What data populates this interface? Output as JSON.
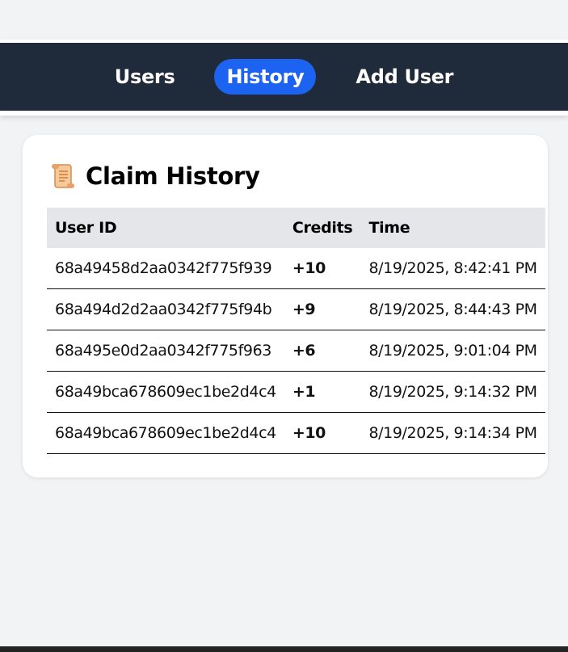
{
  "nav": {
    "items": [
      {
        "label": "Users",
        "active": false
      },
      {
        "label": "History",
        "active": true
      },
      {
        "label": "Add User",
        "active": false
      }
    ],
    "active_color": "#1c63f2",
    "background_color": "#1f2a3a"
  },
  "card": {
    "icon": "scroll-icon",
    "title": "Claim History",
    "columns": [
      "User ID",
      "Credits",
      "Time"
    ],
    "rows": [
      {
        "user_id": "68a49458d2aa0342f775f939",
        "credits": "+10",
        "time": "8/19/2025, 8:42:41 PM"
      },
      {
        "user_id": "68a494d2d2aa0342f775f94b",
        "credits": "+9",
        "time": "8/19/2025, 8:44:43 PM"
      },
      {
        "user_id": "68a495e0d2aa0342f775f963",
        "credits": "+6",
        "time": "8/19/2025, 9:01:04 PM"
      },
      {
        "user_id": "68a49bca678609ec1be2d4c4",
        "credits": "+1",
        "time": "8/19/2025, 9:14:32 PM"
      },
      {
        "user_id": "68a49bca678609ec1be2d4c4",
        "credits": "+10",
        "time": "8/19/2025, 9:14:34 PM"
      }
    ]
  }
}
